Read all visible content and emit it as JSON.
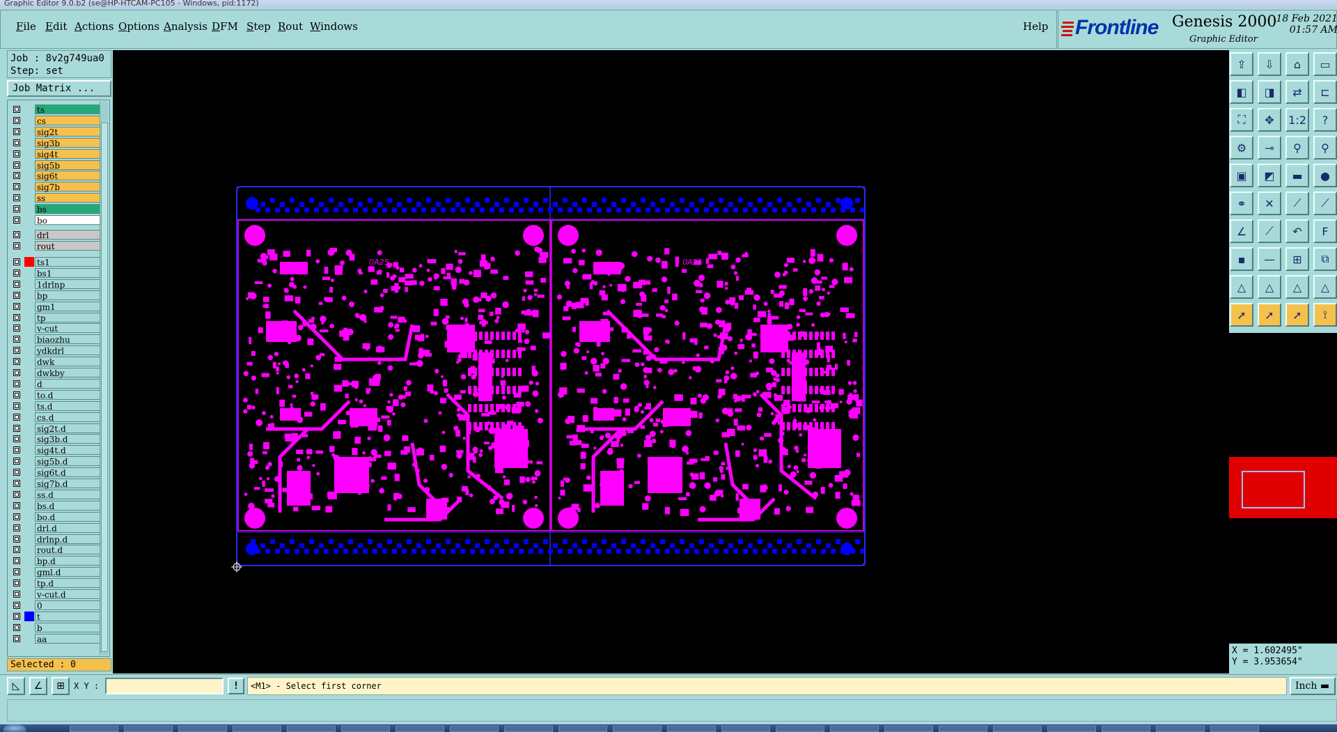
{
  "window": {
    "title": "Graphic Editor 9.0.b2 (se@HP-HTCAM-PC105 - Windows, pid:1172)"
  },
  "menu": {
    "items": [
      "File",
      "Edit",
      "Actions",
      "Options",
      "Analysis",
      "DFM",
      "Step",
      "Rout",
      "Windows"
    ],
    "help": "Help"
  },
  "brand": {
    "logo": "Frontline",
    "product": "Genesis 2000",
    "subtitle": "Graphic Editor",
    "date": "18 Feb 2021",
    "time": "01:57 AM",
    "logo_red": "#cc1111",
    "logo_blue": "#0033aa"
  },
  "job": {
    "job_line": "Job : 8v2g749ua0",
    "step_line": "Step: set",
    "matrix_button": "Job Matrix ..."
  },
  "layers": {
    "board": [
      {
        "name": "ts",
        "color": "#23a978"
      },
      {
        "name": "cs",
        "color": "#f6c04c"
      },
      {
        "name": "sig2t",
        "color": "#f6c04c"
      },
      {
        "name": "sig3b",
        "color": "#f6c04c"
      },
      {
        "name": "sig4t",
        "color": "#f6c04c"
      },
      {
        "name": "sig5b",
        "color": "#f6c04c"
      },
      {
        "name": "sig6t",
        "color": "#f6c04c"
      },
      {
        "name": "sig7b",
        "color": "#f6c04c"
      },
      {
        "name": "ss",
        "color": "#f6c04c"
      },
      {
        "name": "bs",
        "color": "#23a978"
      },
      {
        "name": "bo",
        "color": "#ffffff"
      }
    ],
    "drill": [
      {
        "name": "drl",
        "color": "#c8c8c8"
      },
      {
        "name": "rout",
        "color": "#c8c8c8"
      }
    ],
    "misc": [
      {
        "name": "ts1",
        "color": "#a9dada",
        "swatch": "#ff0000",
        "active": true
      },
      {
        "name": "bs1",
        "color": "#a9dada"
      },
      {
        "name": "1drlnp",
        "color": "#a9dada"
      },
      {
        "name": "bp",
        "color": "#a9dada"
      },
      {
        "name": "gm1",
        "color": "#a9dada"
      },
      {
        "name": "tp",
        "color": "#a9dada"
      },
      {
        "name": "v-cut",
        "color": "#a9dada"
      },
      {
        "name": "biaozhu",
        "color": "#a9dada"
      },
      {
        "name": "ydkdrl",
        "color": "#a9dada"
      },
      {
        "name": "dwk",
        "color": "#a9dada"
      },
      {
        "name": "dwkby",
        "color": "#a9dada"
      },
      {
        "name": "d",
        "color": "#a9dada"
      },
      {
        "name": "to.d",
        "color": "#a9dada"
      },
      {
        "name": "ts.d",
        "color": "#a9dada"
      },
      {
        "name": "cs.d",
        "color": "#a9dada"
      },
      {
        "name": "sig2t.d",
        "color": "#a9dada"
      },
      {
        "name": "sig3b.d",
        "color": "#a9dada"
      },
      {
        "name": "sig4t.d",
        "color": "#a9dada"
      },
      {
        "name": "sig5b.d",
        "color": "#a9dada"
      },
      {
        "name": "sig6t.d",
        "color": "#a9dada"
      },
      {
        "name": "sig7b.d",
        "color": "#a9dada"
      },
      {
        "name": "ss.d",
        "color": "#a9dada"
      },
      {
        "name": "bs.d",
        "color": "#a9dada"
      },
      {
        "name": "bo.d",
        "color": "#a9dada"
      },
      {
        "name": "drl.d",
        "color": "#a9dada"
      },
      {
        "name": "drlnp.d",
        "color": "#a9dada"
      },
      {
        "name": "rout.d",
        "color": "#a9dada"
      },
      {
        "name": "bp.d",
        "color": "#a9dada"
      },
      {
        "name": "gml.d",
        "color": "#a9dada"
      },
      {
        "name": "tp.d",
        "color": "#a9dada"
      },
      {
        "name": "v-cut.d",
        "color": "#a9dada"
      },
      {
        "name": "0",
        "color": "#a9dada"
      },
      {
        "name": "t",
        "color": "#a9dada",
        "swatch": "#0000ff"
      },
      {
        "name": "b",
        "color": "#a9dada"
      },
      {
        "name": "aa",
        "color": "#a9dada"
      }
    ]
  },
  "selected": "Selected : 0",
  "canvas": {
    "background": "#000000",
    "copper_color": "#ff00ff",
    "rail_color": "#0000ff",
    "outline_color": "#2a2aff",
    "board_label": "0A25"
  },
  "coords": {
    "x": "X = 1.602495\"",
    "y": "Y = 3.953654\""
  },
  "command": {
    "xy_label": "X Y :",
    "xy_value": "",
    "exclaim": "!",
    "prompt": "<M1> - Select first corner",
    "units": "Inch"
  },
  "toolbar_icons": [
    "open-job-icon",
    "save-icon",
    "home-icon",
    "window-icon",
    "zoom-in-icon",
    "zoom-out-icon",
    "zoom-back-icon",
    "step-icon",
    "fit-icon",
    "center-icon",
    "one-to-one-icon",
    "help-query-icon",
    "settings-icon",
    "snap-icon",
    "measure-icon",
    "measure-red-icon",
    "pad-icon",
    "shape-icon",
    "line-icon",
    "dot-icon",
    "net-icon",
    "cross-icon",
    "connect-icon",
    "split-icon",
    "line-add-icon",
    "line-add-blue-icon",
    "arc-icon",
    "text-icon",
    "pad-red-icon",
    "dash-icon",
    "symbol-icon",
    "copy-icon",
    "triangle-icon",
    "triangle-alt-icon",
    "triangle-text-icon",
    "triangle-flat-icon",
    "pointer-icon",
    "pointer-select-icon",
    "pointer-box-icon",
    "route-icon"
  ]
}
